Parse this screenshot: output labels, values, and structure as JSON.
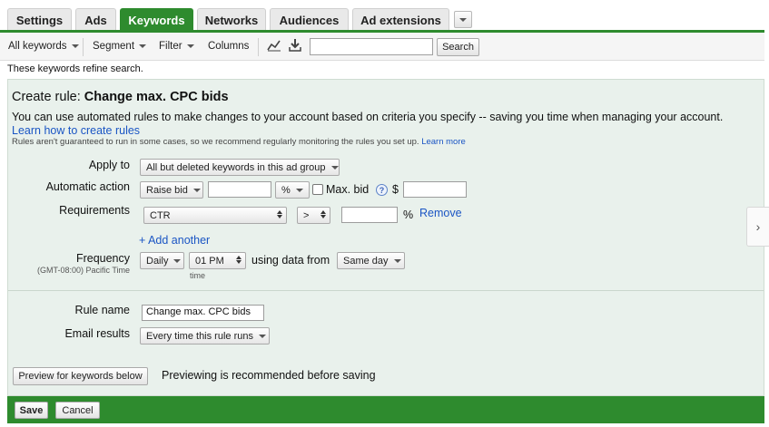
{
  "tabs": [
    {
      "label": "Settings",
      "active": false
    },
    {
      "label": "Ads",
      "active": false
    },
    {
      "label": "Keywords",
      "active": true
    },
    {
      "label": "Networks",
      "active": false
    },
    {
      "label": "Audiences",
      "active": false
    },
    {
      "label": "Ad extensions",
      "active": false
    }
  ],
  "toolbar": {
    "all_keywords": "All keywords",
    "segment": "Segment",
    "filter": "Filter",
    "columns": "Columns",
    "search_value": "",
    "search_button": "Search",
    "icons": [
      "line-chart-icon",
      "download-icon"
    ]
  },
  "info_line": "These keywords refine search.",
  "rule": {
    "title_prefix": "Create rule:",
    "title": "Change max. CPC bids",
    "description": "You can use automated rules to make changes to your account based on criteria you specify -- saving you time when managing your account.",
    "learn_link": "Learn how to create rules",
    "note": "Rules aren't guaranteed to run in some cases, so we recommend regularly monitoring the rules you set up.",
    "note_link": "Learn more",
    "apply_to_label": "Apply to",
    "apply_to_value": "All but deleted keywords in this ad group",
    "action_label": "Automatic action",
    "action_value": "Raise bid",
    "action_amount": "",
    "action_unit": "%",
    "max_bid_label": "Max. bid",
    "max_bid_checked": false,
    "currency": "$",
    "max_bid_value": "",
    "requirements_label": "Requirements",
    "req_metric": "CTR",
    "req_operator": ">",
    "req_value": "",
    "req_unit": "%",
    "remove_link": "Remove",
    "add_another": "+ Add another",
    "frequency_label": "Frequency",
    "timezone": "(GMT-08:00) Pacific Time",
    "frequency_value": "Daily",
    "time_value": "01 PM",
    "time_caption": "time",
    "using_data_from": "using data from",
    "data_range": "Same day",
    "rule_name_label": "Rule name",
    "rule_name_value": "Change max. CPC bids",
    "email_label": "Email results",
    "email_value": "Every time this rule runs",
    "preview_button": "Preview for keywords below",
    "preview_note": "Previewing is recommended before saving"
  },
  "footer": {
    "save": "Save",
    "cancel": "Cancel"
  },
  "side_arrow": "›",
  "colors": {
    "accent_green": "#2e8b2e",
    "panel_bg": "#e9f1ec",
    "link_blue": "#1a55c4"
  }
}
